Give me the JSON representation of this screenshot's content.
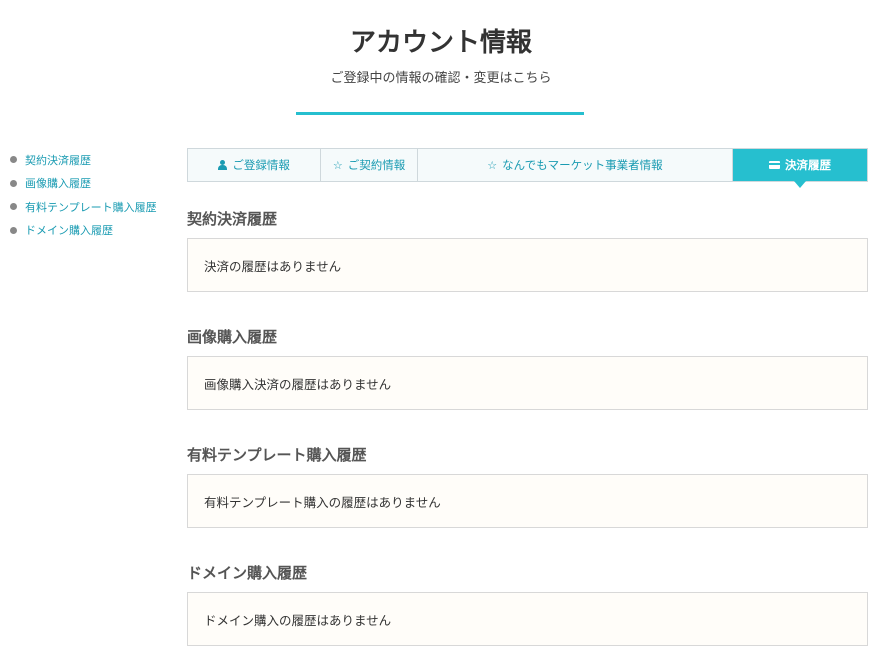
{
  "header": {
    "title": "アカウント情報",
    "subtitle": "ご登録中の情報の確認・変更はこちら"
  },
  "colors": {
    "accent": "#26bfcf",
    "link": "#1a9bb2"
  },
  "sidebar": {
    "items": [
      {
        "label": "契約決済履歴"
      },
      {
        "label": "画像購入履歴"
      },
      {
        "label": "有料テンプレート購入履歴"
      },
      {
        "label": "ドメイン購入履歴"
      }
    ]
  },
  "tabs": [
    {
      "label": "ご登録情報",
      "icon": "user-icon",
      "active": false
    },
    {
      "label": "ご契約情報",
      "icon": "star-icon",
      "active": false
    },
    {
      "label": "なんでもマーケット事業者情報",
      "icon": "star-icon",
      "active": false
    },
    {
      "label": "決済履歴",
      "icon": "credit-card-icon",
      "active": true
    }
  ],
  "sections": [
    {
      "title": "契約決済履歴",
      "message": "決済の履歴はありません"
    },
    {
      "title": "画像購入履歴",
      "message": "画像購入決済の履歴はありません"
    },
    {
      "title": "有料テンプレート購入履歴",
      "message": "有料テンプレート購入の履歴はありません"
    },
    {
      "title": "ドメイン購入履歴",
      "message": "ドメイン購入の履歴はありません"
    }
  ]
}
